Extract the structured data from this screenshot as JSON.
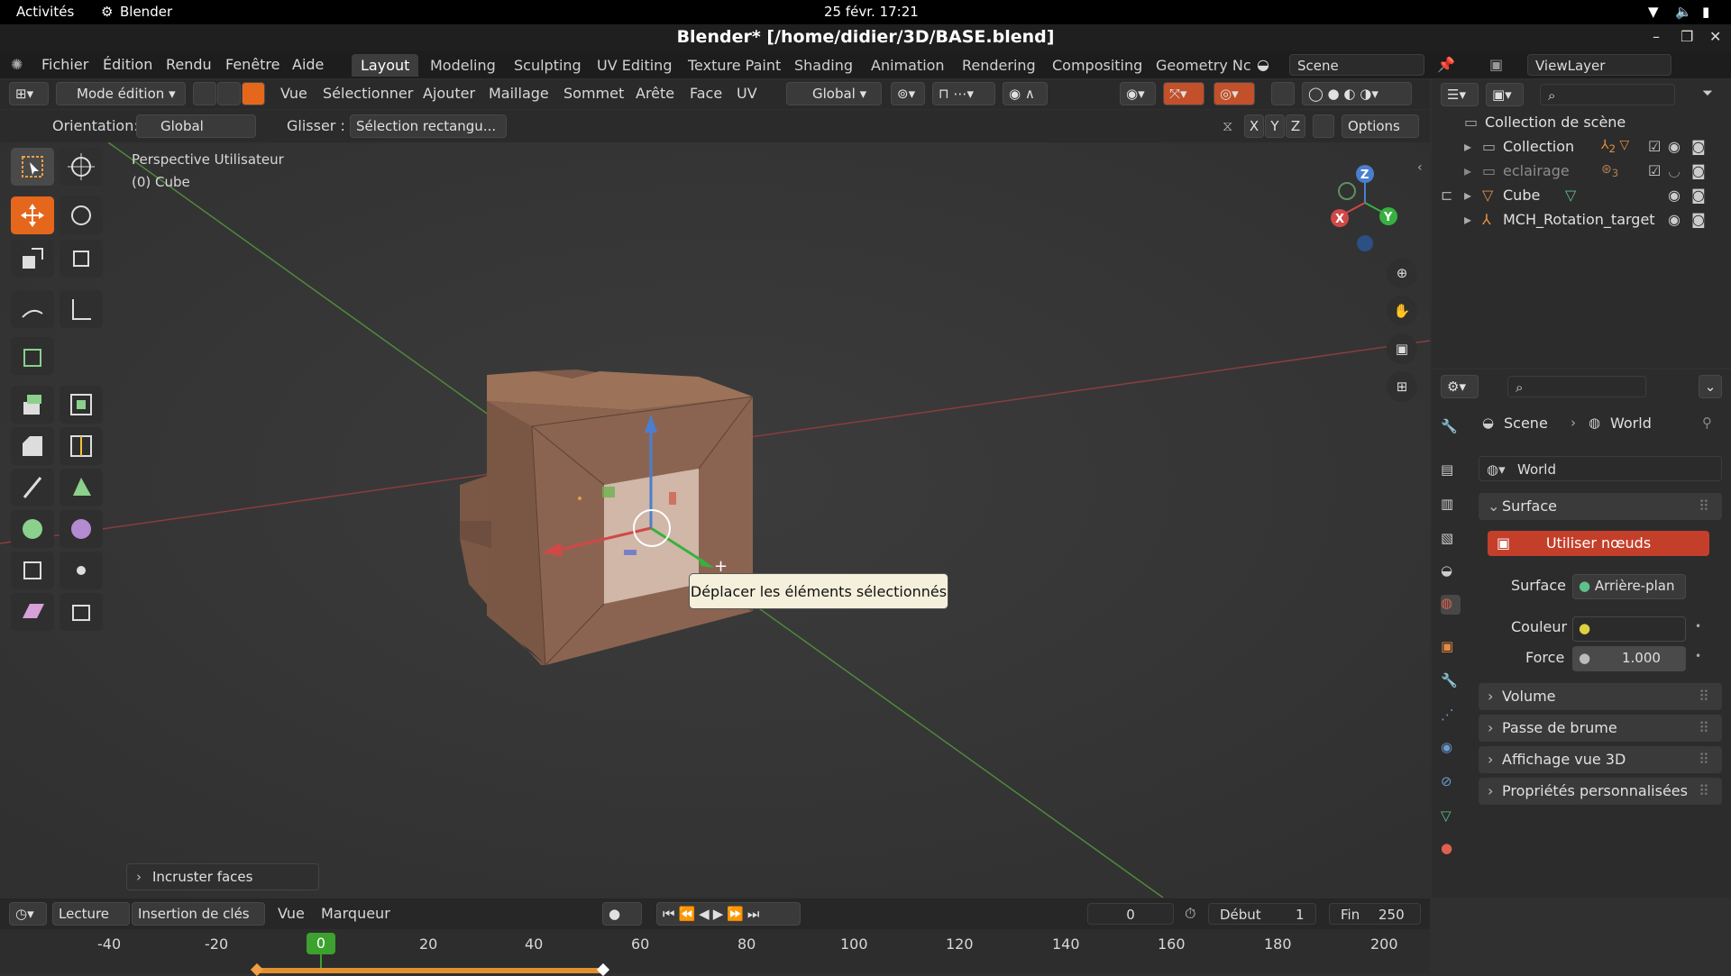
{
  "gnome": {
    "activities": "Activités",
    "app": "Blender",
    "datetime": "25 févr.  17:21"
  },
  "window": {
    "title": "Blender* [/home/didier/3D/BASE.blend]"
  },
  "menus": [
    "Fichier",
    "Édition",
    "Rendu",
    "Fenêtre",
    "Aide"
  ],
  "workspaces": [
    "Layout",
    "Modeling",
    "Sculpting",
    "UV Editing",
    "Texture Paint",
    "Shading",
    "Animation",
    "Rendering",
    "Compositing",
    "Geometry Nc"
  ],
  "scene": {
    "name": "Scene",
    "viewlayer": "ViewLayer"
  },
  "vp_header": {
    "mode": "Mode édition",
    "items": [
      "Vue",
      "Sélectionner",
      "Ajouter",
      "Maillage",
      "Sommet",
      "Arête",
      "Face",
      "UV"
    ],
    "transform": "Global"
  },
  "tool_header": {
    "orientation_label": "Orientation:",
    "orientation": "Global",
    "drag_label": "Glisser :",
    "drag": "Sélection rectangu...",
    "options": "Options",
    "axes": [
      "X",
      "Y",
      "Z"
    ]
  },
  "viewport": {
    "perspective": "Perspective Utilisateur",
    "object": "(0) Cube",
    "last_op": "Incruster faces",
    "tooltip": "Déplacer les éléments sélectionnés"
  },
  "gizmo": {
    "x": "X",
    "y": "Y",
    "z": "Z"
  },
  "outliner": {
    "root": "Collection de scène",
    "items": [
      {
        "name": "Collection",
        "badge": "2"
      },
      {
        "name": "eclairage",
        "badge": "3"
      },
      {
        "name": "Cube",
        "badge": ""
      },
      {
        "name": "MCH_Rotation_target",
        "badge": ""
      }
    ]
  },
  "properties": {
    "breadcrumb": [
      "Scene",
      "World"
    ],
    "world_name": "World",
    "surface_panel": "Surface",
    "use_nodes": "Utiliser nœuds",
    "surface_label": "Surface",
    "surface_value": "Arrière-plan",
    "color_label": "Couleur",
    "force_label": "Force",
    "force_value": "1.000",
    "panels": [
      "Volume",
      "Passe de brume",
      "Affichage vue 3D",
      "Propriétés personnalisées"
    ]
  },
  "timeline": {
    "items": [
      "Lecture",
      "Insertion de clés",
      "Vue",
      "Marqueur"
    ],
    "current": "0",
    "start_label": "Début",
    "start": "1",
    "end_label": "Fin",
    "end": "250",
    "ticks": [
      "-40",
      "-20",
      "0",
      "20",
      "40",
      "60",
      "80",
      "100",
      "120",
      "140",
      "160",
      "180",
      "200"
    ]
  },
  "colors": {
    "accent": "#e5671c",
    "use_nodes": "#c43f2a",
    "selected_tab": "#3d3d3d"
  }
}
